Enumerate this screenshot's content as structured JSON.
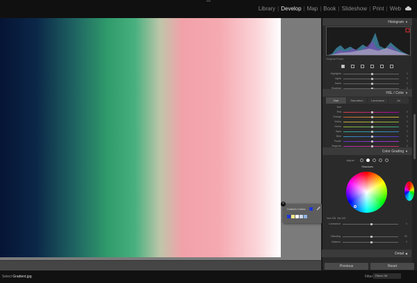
{
  "top_nav": {
    "modules": [
      {
        "label": "Library"
      },
      {
        "label": "Develop"
      },
      {
        "label": "Map"
      },
      {
        "label": "Book"
      },
      {
        "label": "Slideshow"
      },
      {
        "label": "Print"
      },
      {
        "label": "Web"
      }
    ],
    "active_module": "Develop"
  },
  "panel": {
    "histogram_title": "Histogram",
    "histogram_info": "Original Photo",
    "tone_sliders": [
      {
        "label": "Highlights",
        "value": "0"
      },
      {
        "label": "Lights",
        "value": "0"
      },
      {
        "label": "Darks",
        "value": "0"
      },
      {
        "label": "Shadows",
        "value": "0"
      }
    ],
    "hsl_title": "HSL / Color",
    "hsl_tabs": [
      "Hue",
      "Saturation",
      "Luminance",
      "All"
    ],
    "hsl_subhead": "Hue",
    "hsl_sliders": [
      {
        "label": "Red",
        "value": "0"
      },
      {
        "label": "Orange",
        "value": "0"
      },
      {
        "label": "Yellow",
        "value": "0"
      },
      {
        "label": "Green",
        "value": "0"
      },
      {
        "label": "Aqua",
        "value": "0"
      },
      {
        "label": "Blue",
        "value": "0"
      },
      {
        "label": "Purple",
        "value": "0"
      },
      {
        "label": "Magenta",
        "value": "0"
      }
    ],
    "color_grading_title": "Color Grading",
    "adjust_label": "Adjust",
    "wheel_label": "Shadows",
    "hue_row": {
      "hue_label": "Hue",
      "hue_value": "226",
      "sat_label": "Sat",
      "sat_value": "100"
    },
    "bottom_sliders": [
      {
        "label": "Luminance",
        "value": "0"
      },
      {
        "label": "Blending",
        "value": "50"
      },
      {
        "label": "Balance",
        "value": "0"
      }
    ],
    "detail_title": "Detail",
    "previous_label": "Previous",
    "reset_label": "Reset"
  },
  "popup": {
    "title": "Custom Colors",
    "current_color": "#1b36d6",
    "swatches": [
      "#1b36d6",
      "#ffe98a",
      "#ffffff",
      "#c9d9f0",
      "#8fb3e0"
    ]
  },
  "status": {
    "file_prefix": "Select",
    "file_name": "Gradient.jpg",
    "filter_label": "Filter:",
    "filter_value": "Filters Off"
  },
  "colors": {
    "accent": "#1b36d6",
    "panel_bg": "#2a2a2a",
    "canvas_bg": "#7b7b7b"
  }
}
